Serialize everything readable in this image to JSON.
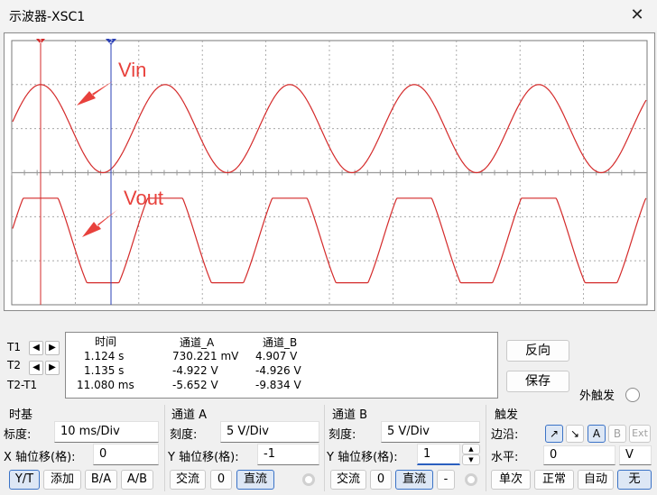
{
  "window": {
    "title": "示波器-XSC1",
    "close_glyph": "✕"
  },
  "screen": {
    "annotations": {
      "vin": "Vin",
      "vout": "Vout"
    },
    "cursor_t1_marker": "1",
    "cursor_t2_marker": "2",
    "colors": {
      "trace": "#d42a2a",
      "cursor_t1": "#d42a2a",
      "cursor_t2": "#2a3fb5",
      "grid": "#9a9a9a",
      "annotation": "#e8413c"
    }
  },
  "measurements": {
    "headers": {
      "time": "时间",
      "channel_a": "通道_A",
      "channel_b": "通道_B"
    },
    "row_labels": {
      "t1": "T1",
      "t2": "T2",
      "diff": "T2-T1"
    },
    "rows": [
      {
        "time": "1.124 s",
        "a": "730.221 mV",
        "b": "4.907 V"
      },
      {
        "time": "1.135 s",
        "a": "-4.922 V",
        "b": "-4.926 V"
      },
      {
        "time": "11.080 ms",
        "a": "-5.652 V",
        "b": "-9.834 V"
      }
    ],
    "arrow_left": "◀",
    "arrow_right": "▶"
  },
  "buttons": {
    "reverse": "反向",
    "save": "保存",
    "ext_trigger": "外触发"
  },
  "timebase": {
    "title": "时基",
    "scale_label": "标度:",
    "scale_value": "10 ms/Div",
    "xpos_label": "X 轴位移(格):",
    "xpos_value": "0",
    "modes": {
      "yt": "Y/T",
      "add": "添加",
      "ba": "B/A",
      "ab": "A/B"
    }
  },
  "channel_a": {
    "title": "通道 A",
    "scale_label": "刻度:",
    "scale_value": "5  V/Div",
    "ypos_label": "Y 轴位移(格):",
    "ypos_value": "-1",
    "coupling": {
      "ac": "交流",
      "zero": "0",
      "dc": "直流"
    }
  },
  "channel_b": {
    "title": "通道 B",
    "scale_label": "刻度:",
    "scale_value": "5  V/Div",
    "ypos_label": "Y 轴位移(格):",
    "ypos_value": "1",
    "coupling": {
      "ac": "交流",
      "zero": "0",
      "dc": "直流",
      "minus": "-"
    }
  },
  "trigger": {
    "title": "触发",
    "edge_label": "边沿:",
    "edge_rise": "↗",
    "edge_fall": "↘",
    "src_a": "A",
    "src_b": "B",
    "src_ext": "Ext",
    "level_label": "水平:",
    "level_value": "0",
    "level_unit": "V",
    "modes": {
      "single": "单次",
      "normal": "正常",
      "auto": "自动",
      "none": "无"
    }
  }
}
